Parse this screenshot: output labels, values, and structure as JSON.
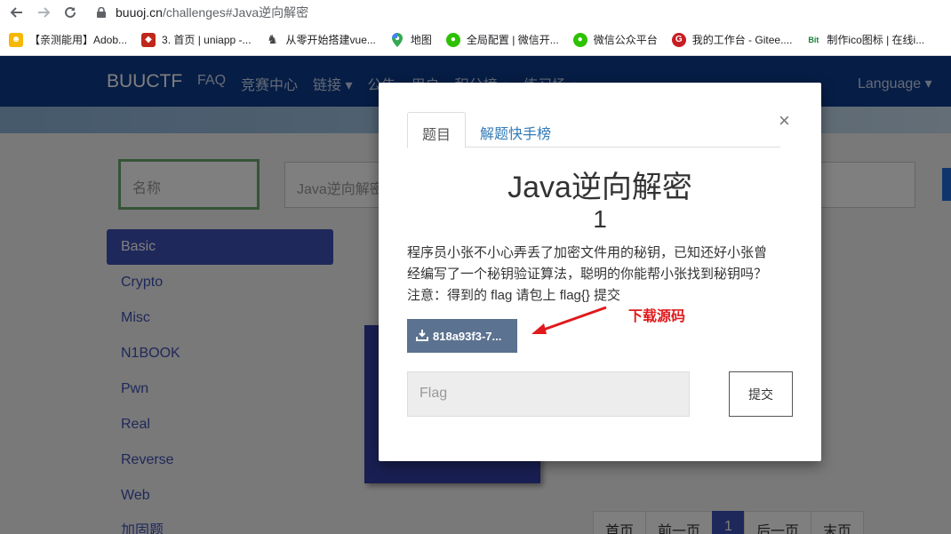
{
  "browser": {
    "url_host": "buuoj.cn",
    "url_path": "/challenges#Java逆向解密",
    "bookmarks": [
      {
        "label": "【亲测能用】Adob...",
        "icon": "pixel-bird-icon",
        "color": "#f6b800"
      },
      {
        "label": "3. 首页 | uniapp -...",
        "icon": "red-square-icon",
        "color": "#c0281c"
      },
      {
        "label": "从零开始搭建vue...",
        "icon": "horse-icon",
        "color": "#444444"
      },
      {
        "label": "地图",
        "icon": "maps-pin-icon",
        "color": "#34a853"
      },
      {
        "label": "全局配置 | 微信开...",
        "icon": "wechat-icon",
        "color": "#2dc100"
      },
      {
        "label": "微信公众平台",
        "icon": "wechat-icon",
        "color": "#2dc100"
      },
      {
        "label": "我的工作台 - Gitee....",
        "icon": "gitee-icon",
        "color": "#c71d23"
      },
      {
        "label": "制作ico图标 | 在线i...",
        "icon": "bit-icon",
        "color": "#1b7f3b"
      }
    ]
  },
  "site": {
    "brand": "BUUCTF",
    "nav": [
      "FAQ",
      "竞赛中心",
      "链接",
      "公告",
      "用户",
      "积分榜",
      "练习场"
    ],
    "language": "Language",
    "search_placeholder": "名称",
    "search2_value": "Java逆向解密",
    "sidebar": [
      "Basic",
      "Crypto",
      "Misc",
      "N1BOOK",
      "Pwn",
      "Real",
      "Reverse",
      "Web",
      "加固题"
    ],
    "sidebar_active": "Basic",
    "pager": [
      "首页",
      "前一页",
      "1",
      "后一页",
      "末页"
    ]
  },
  "modal": {
    "tabs": [
      "题目",
      "解题快手榜"
    ],
    "title": "Java逆向解密",
    "value": "1",
    "description": [
      "程序员小张不小心弄丢了加密文件用的秘钥，已知还好小张曾",
      "经编写了一个秘钥验证算法，聪明的你能帮小张找到秘钥吗？",
      "注意：得到的 flag 请包上 flag{} 提交"
    ],
    "download_label": "818a93f3-7...",
    "flag_placeholder": "Flag",
    "submit_label": "提交",
    "close_glyph": "×"
  },
  "annotation": {
    "text": "下载源码",
    "color": "#e0191c"
  },
  "colors": {
    "nav_bg": "#0c3a8a",
    "accent": "#3f51b5",
    "download_btn": "#5b7290"
  }
}
